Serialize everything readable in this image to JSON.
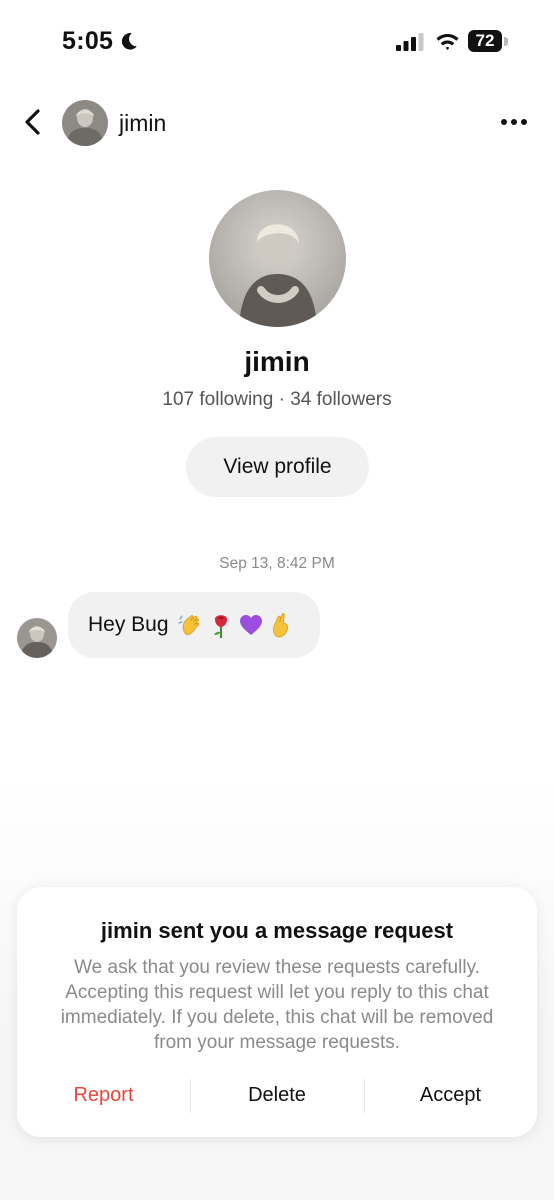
{
  "status_bar": {
    "time": "5:05",
    "battery": "72",
    "icons": [
      "moon-icon",
      "signal-icon",
      "wifi-icon",
      "battery-icon"
    ]
  },
  "header": {
    "name": "jimin",
    "icons": [
      "chevron-left-icon",
      "more-horizontal-icon"
    ]
  },
  "profile": {
    "name": "jimin",
    "stats": "107 following · 34 followers",
    "view_profile_label": "View profile"
  },
  "conversation": {
    "timestamp": "Sep 13, 8:42 PM",
    "message_text": "Hey Bug",
    "message_emojis": [
      "waving-hand-emoji",
      "rose-emoji",
      "purple-heart-emoji",
      "crossed-fingers-emoji"
    ]
  },
  "request_card": {
    "title": "jimin sent you a message request",
    "body": "We ask that you review these requests carefully. Accepting this request will let you reply to this chat immediately. If you delete, this chat will be removed from your message requests.",
    "report_label": "Report",
    "delete_label": "Delete",
    "accept_label": "Accept"
  },
  "colors": {
    "report": "#e8463c",
    "bubble": "#f1f1f2",
    "secondary_text": "#8a8a8a"
  }
}
